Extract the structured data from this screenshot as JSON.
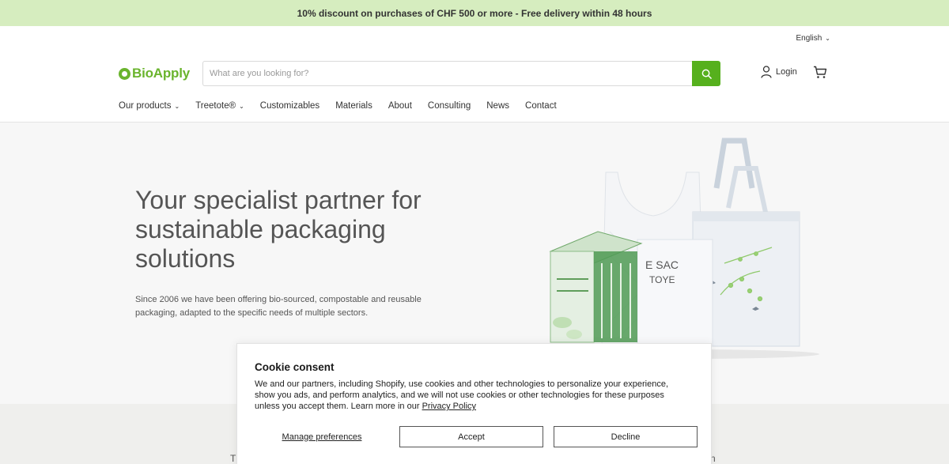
{
  "announcement": {
    "text": "10% discount on purchases of CHF 500 or more - Free delivery within 48 hours"
  },
  "language": {
    "selected": "English"
  },
  "header": {
    "logo_text": "BioApply",
    "search_placeholder": "What are you looking for?",
    "login_label": "Login"
  },
  "nav": {
    "items": [
      {
        "label": "Our products",
        "dropdown": true
      },
      {
        "label": "Treetote®",
        "dropdown": true
      },
      {
        "label": "Customizables",
        "dropdown": false
      },
      {
        "label": "Materials",
        "dropdown": false
      },
      {
        "label": "About",
        "dropdown": false
      },
      {
        "label": "Consulting",
        "dropdown": false
      },
      {
        "label": "News",
        "dropdown": false
      },
      {
        "label": "Contact",
        "dropdown": false
      }
    ]
  },
  "hero": {
    "title": "Your specialist partner for sustainable packaging solutions",
    "text": "Since 2006 we have been offering bio-sourced, compostable and reusable packaging, adapted to the specific needs of multiple sectors.",
    "bag_print_1": "E SAC",
    "bag_print_2": "TOYE"
  },
  "band": {
    "left_fragment": "T",
    "right_fragment": "n"
  },
  "cookie": {
    "title": "Cookie consent",
    "body": "We and our partners, including Shopify, use cookies and other technologies to personalize your experience, show you ads, and perform analytics, and we will not use cookies or other technologies for these purposes unless you accept them. Learn more in our ",
    "privacy_link": "Privacy Policy",
    "manage_label": "Manage preferences",
    "accept_label": "Accept",
    "decline_label": "Decline"
  },
  "colors": {
    "brand_green": "#56b01d",
    "announcement_bg": "#d6edbf"
  }
}
